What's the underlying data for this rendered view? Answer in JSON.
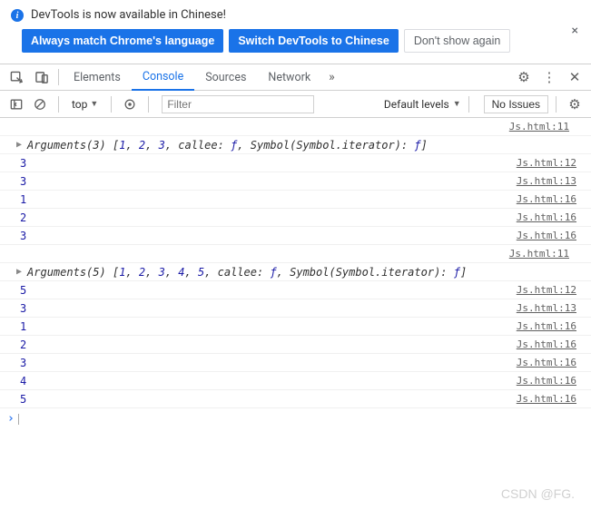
{
  "info_bar": {
    "message": "DevTools is now available in Chinese!"
  },
  "buttons": {
    "match_lang": "Always match Chrome's language",
    "switch_chinese": "Switch DevTools to Chinese",
    "dont_show": "Don't show again"
  },
  "tabs": {
    "elements": "Elements",
    "console": "Console",
    "sources": "Sources",
    "network": "Network"
  },
  "console_toolbar": {
    "context": "top",
    "filter_placeholder": "Filter",
    "levels_label": "Default levels",
    "issues_label": "No Issues"
  },
  "logs": [
    {
      "type": "link",
      "link": "Js.html:11"
    },
    {
      "type": "args",
      "count": 3,
      "values": [
        1,
        2,
        3
      ]
    },
    {
      "type": "value",
      "value": "3",
      "link": "Js.html:12"
    },
    {
      "type": "value",
      "value": "3",
      "link": "Js.html:13"
    },
    {
      "type": "value",
      "value": "1",
      "link": "Js.html:16"
    },
    {
      "type": "value",
      "value": "2",
      "link": "Js.html:16"
    },
    {
      "type": "value",
      "value": "3",
      "link": "Js.html:16"
    },
    {
      "type": "link",
      "link": "Js.html:11"
    },
    {
      "type": "args",
      "count": 5,
      "values": [
        1,
        2,
        3,
        4,
        5
      ]
    },
    {
      "type": "value",
      "value": "5",
      "link": "Js.html:12"
    },
    {
      "type": "value",
      "value": "3",
      "link": "Js.html:13"
    },
    {
      "type": "value",
      "value": "1",
      "link": "Js.html:16"
    },
    {
      "type": "value",
      "value": "2",
      "link": "Js.html:16"
    },
    {
      "type": "value",
      "value": "3",
      "link": "Js.html:16"
    },
    {
      "type": "value",
      "value": "4",
      "link": "Js.html:16"
    },
    {
      "type": "value",
      "value": "5",
      "link": "Js.html:16"
    }
  ],
  "args_template": {
    "prefix": "Arguments",
    "callee": "callee: ",
    "symbol": "Symbol(Symbol.iterator): ",
    "f": "ƒ"
  },
  "watermark": "CSDN @FG."
}
